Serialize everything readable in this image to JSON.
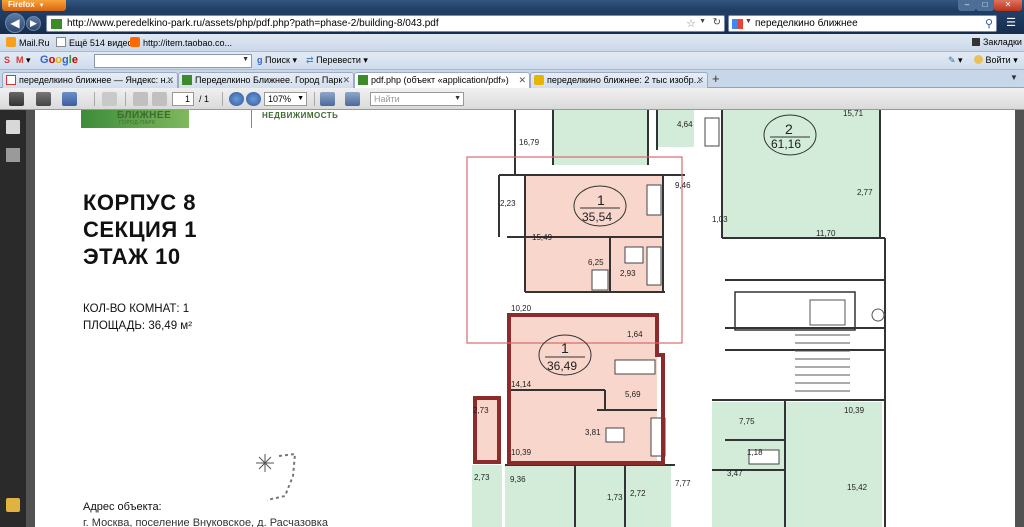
{
  "window": {
    "app_button": "Firefox",
    "controls": {
      "minimize": "–",
      "maximize": "□",
      "close": "✕"
    }
  },
  "nav": {
    "url": "http://www.peredelkino-park.ru/assets/php/pdf.php?path=phase-2/building-8/043.pdf",
    "search_text": "переделкино ближнее"
  },
  "bookmarks": [
    {
      "label": "Mail.Ru",
      "icon": "mailru-icon"
    },
    {
      "label": "Ещё 514 видео",
      "icon": "page-icon"
    },
    {
      "label": "http://item.taobao.co...",
      "icon": "taobao-icon"
    }
  ],
  "bookmarks_right": "Закладки",
  "google_toolbar": {
    "logo": "Google",
    "search_label": "Поиск",
    "translate_label": "Перевести",
    "login_label": "Войти"
  },
  "tabs": [
    {
      "label": "переделкино ближнее — Яндекс: н...",
      "icon_color": "#d33",
      "active": false
    },
    {
      "label": "Переделкино Ближнее. Город Парк",
      "icon_color": "#3b8b2a",
      "active": false
    },
    {
      "label": "pdf.php (объект «application/pdf»)",
      "icon_color": "#3b8b2a",
      "active": true
    },
    {
      "label": "переделкино ближнее: 2 тыс изобр...",
      "icon_color": "#e8b400",
      "active": false
    }
  ],
  "pdf_toolbar": {
    "page_current": "1",
    "page_total": "/ 1",
    "zoom": "107%",
    "find_placeholder": "Найти"
  },
  "document": {
    "brand": {
      "name": "БЛИЖНЕЕ",
      "sub": "ГОРОД-ПАРК",
      "realty": "НЕДВИЖИМОСТЬ"
    },
    "heading_lines": [
      "КОРПУС 8",
      "СЕКЦИЯ 1",
      "ЭТАЖ 10"
    ],
    "rooms_label": "КОЛ-ВО КОМНАТ: 1",
    "area_label": "ПЛОЩАДЬ: 36,49 м²",
    "address_label": "Адрес объекта:",
    "address_text": "г. Москва, поселение Внуковское, д. Расчазовка",
    "plan_labels": {
      "apt_top_rooms": "1",
      "apt_top_area": "35,54",
      "apt_sel_rooms": "1",
      "apt_sel_area": "36,49",
      "apt_right_rooms": "2",
      "apt_right_area": "61,16",
      "areas": [
        "16,79",
        "4,64",
        "15,71",
        "2,23",
        "15,49",
        "6,25",
        "2,93",
        "10,20",
        "1,64",
        "14,14",
        "5,69",
        "2,73",
        "3,81",
        "10,39",
        "9,46",
        "1,03",
        "11,70",
        "2,77",
        "7,75",
        "1,18",
        "3,47",
        "10,39",
        "15,42",
        "2,73",
        "9,36",
        "1,73",
        "2,72",
        "7,77"
      ]
    }
  }
}
